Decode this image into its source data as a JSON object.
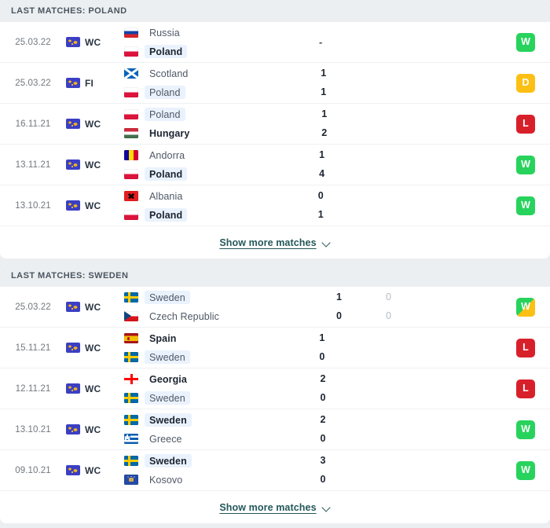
{
  "sections": [
    {
      "id": "poland",
      "header": "LAST MATCHES: POLAND",
      "show_more": "Show more matches",
      "matches": [
        {
          "date": "25.03.22",
          "competition": "WC",
          "home": {
            "name": "Russia",
            "flag": "f-russia",
            "bold": false,
            "highlight": false,
            "score": "",
            "score2": ""
          },
          "away": {
            "name": "Poland",
            "flag": "f-poland",
            "bold": true,
            "highlight": true,
            "score": "",
            "score2": ""
          },
          "no_score": true,
          "dash": "-",
          "result": "W",
          "result_type": "w",
          "corner": false
        },
        {
          "date": "25.03.22",
          "competition": "FI",
          "home": {
            "name": "Scotland",
            "flag": "f-scotland",
            "bold": false,
            "highlight": false,
            "score": "1",
            "score2": ""
          },
          "away": {
            "name": "Poland",
            "flag": "f-poland",
            "bold": false,
            "highlight": true,
            "score": "1",
            "score2": ""
          },
          "no_score": false,
          "dash": "",
          "result": "D",
          "result_type": "d",
          "corner": false
        },
        {
          "date": "16.11.21",
          "competition": "WC",
          "home": {
            "name": "Poland",
            "flag": "f-poland",
            "bold": false,
            "highlight": true,
            "score": "1",
            "score2": ""
          },
          "away": {
            "name": "Hungary",
            "flag": "f-hungary",
            "bold": true,
            "highlight": false,
            "score": "2",
            "score2": ""
          },
          "no_score": false,
          "dash": "",
          "result": "L",
          "result_type": "l",
          "corner": false
        },
        {
          "date": "13.11.21",
          "competition": "WC",
          "home": {
            "name": "Andorra",
            "flag": "f-andorra",
            "bold": false,
            "highlight": false,
            "score": "1",
            "score2": ""
          },
          "away": {
            "name": "Poland",
            "flag": "f-poland",
            "bold": true,
            "highlight": true,
            "score": "4",
            "score2": ""
          },
          "no_score": false,
          "dash": "",
          "result": "W",
          "result_type": "w",
          "corner": false
        },
        {
          "date": "13.10.21",
          "competition": "WC",
          "home": {
            "name": "Albania",
            "flag": "f-albania",
            "bold": false,
            "highlight": false,
            "score": "0",
            "score2": ""
          },
          "away": {
            "name": "Poland",
            "flag": "f-poland",
            "bold": true,
            "highlight": true,
            "score": "1",
            "score2": ""
          },
          "no_score": false,
          "dash": "",
          "result": "W",
          "result_type": "w",
          "corner": false
        }
      ]
    },
    {
      "id": "sweden",
      "header": "LAST MATCHES: SWEDEN",
      "show_more": "Show more matches",
      "matches": [
        {
          "date": "25.03.22",
          "competition": "WC",
          "home": {
            "name": "Sweden",
            "flag": "f-sweden",
            "bold": false,
            "highlight": true,
            "score": "1",
            "score2": "0"
          },
          "away": {
            "name": "Czech Republic",
            "flag": "f-czech",
            "bold": false,
            "highlight": false,
            "score": "0",
            "score2": "0"
          },
          "no_score": false,
          "dash": "",
          "result": "W",
          "result_type": "w",
          "corner": true
        },
        {
          "date": "15.11.21",
          "competition": "WC",
          "home": {
            "name": "Spain",
            "flag": "f-spain",
            "bold": true,
            "highlight": false,
            "score": "1",
            "score2": ""
          },
          "away": {
            "name": "Sweden",
            "flag": "f-sweden",
            "bold": false,
            "highlight": true,
            "score": "0",
            "score2": ""
          },
          "no_score": false,
          "dash": "",
          "result": "L",
          "result_type": "l",
          "corner": false
        },
        {
          "date": "12.11.21",
          "competition": "WC",
          "home": {
            "name": "Georgia",
            "flag": "f-georgia",
            "bold": true,
            "highlight": false,
            "score": "2",
            "score2": ""
          },
          "away": {
            "name": "Sweden",
            "flag": "f-sweden",
            "bold": false,
            "highlight": true,
            "score": "0",
            "score2": ""
          },
          "no_score": false,
          "dash": "",
          "result": "L",
          "result_type": "l",
          "corner": false
        },
        {
          "date": "13.10.21",
          "competition": "WC",
          "home": {
            "name": "Sweden",
            "flag": "f-sweden",
            "bold": true,
            "highlight": true,
            "score": "2",
            "score2": ""
          },
          "away": {
            "name": "Greece",
            "flag": "f-greece",
            "bold": false,
            "highlight": false,
            "score": "0",
            "score2": ""
          },
          "no_score": false,
          "dash": "",
          "result": "W",
          "result_type": "w",
          "corner": false
        },
        {
          "date": "09.10.21",
          "competition": "WC",
          "home": {
            "name": "Sweden",
            "flag": "f-sweden",
            "bold": true,
            "highlight": true,
            "score": "3",
            "score2": ""
          },
          "away": {
            "name": "Kosovo",
            "flag": "f-kosovo",
            "bold": false,
            "highlight": false,
            "score": "0",
            "score2": ""
          },
          "no_score": false,
          "dash": "",
          "result": "W",
          "result_type": "w",
          "corner": false
        }
      ]
    }
  ],
  "icons": {
    "competition_icon": "world-cup-globe-icon",
    "chevron": "chevron-down-icon"
  }
}
